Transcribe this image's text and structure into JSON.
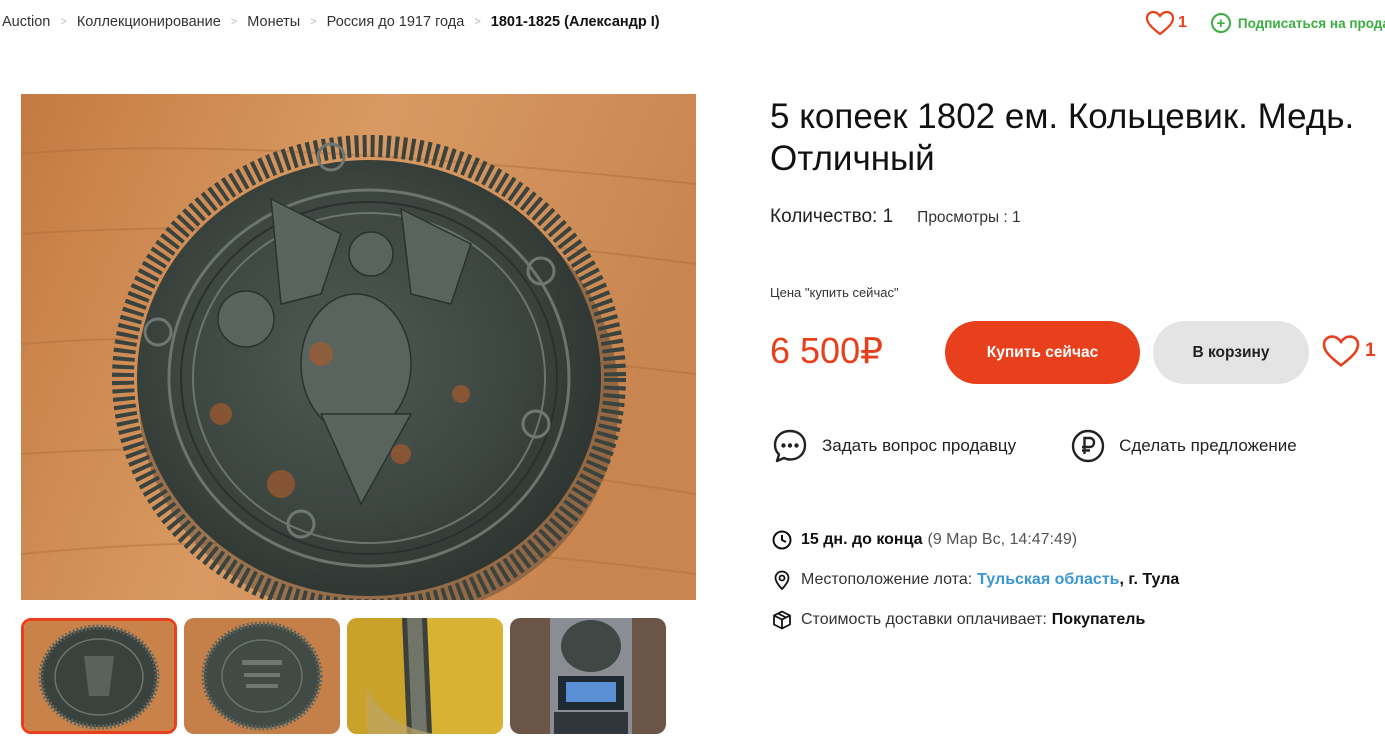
{
  "breadcrumb": {
    "items": [
      "Auction",
      "Коллекционирование",
      "Монеты",
      "Россия до 1917 года"
    ],
    "current": "1801-1825 (Александр I)",
    "separator": ">"
  },
  "header": {
    "favorites_count": "1",
    "subscribe_label": "Подписаться на продавца",
    "subscribe_plus": "+"
  },
  "lot": {
    "title": "5 копеек 1802 ем. Кольцевик. Медь. Отличный",
    "quantity": "Количество: 1",
    "views": "Просмотры : 1",
    "price_caption": "Цена \"купить сейчас\"",
    "price": "6 500₽",
    "buy_now_label": "Купить сейчас",
    "to_cart_label": "В корзину",
    "favorites_count": "1"
  },
  "actions": {
    "ask_seller": "Задать вопрос продавцу",
    "make_offer": "Сделать предложение"
  },
  "info": {
    "time_left": "15 дн. до конца",
    "end_date": "(9 Мар Вс, 14:47:49)",
    "location_label": "Местоположение лота:",
    "location_region": "Тульская область",
    "location_city": ", г. Тула",
    "shipping_label": "Стоимость доставки оплачивает:",
    "shipping_payer": "Покупатель"
  },
  "gallery": {
    "thumbnails": [
      "coin-obverse",
      "coin-reverse",
      "coin-edge",
      "coin-on-scale"
    ],
    "selected_index": 0
  },
  "colors": {
    "accent": "#e8401c",
    "subscribe": "#3aae3e",
    "link": "#3a97d4",
    "cart_button": "#e4e4e4"
  },
  "icons": {
    "heart": "heart-icon",
    "plus": "plus-circle-icon",
    "chat": "chat-bubble-icon",
    "ruble": "ruble-circle-icon",
    "clock": "clock-icon",
    "location": "location-pin-icon",
    "box": "box-icon"
  }
}
